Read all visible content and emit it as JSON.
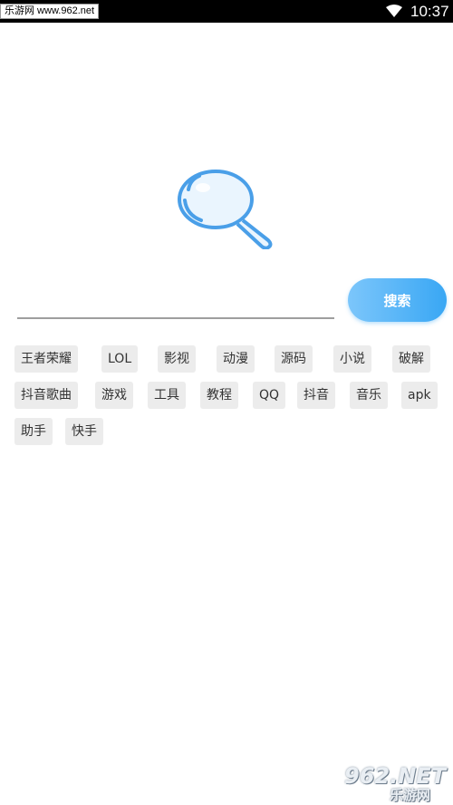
{
  "status_bar": {
    "watermark": "乐游网 www.962.net",
    "time": "10:37",
    "wifi_icon": "wifi-icon"
  },
  "logo": {
    "icon": "magnifier-bubble-icon",
    "color": "#4a9fe8"
  },
  "search": {
    "input_value": "",
    "button_label": "搜索",
    "accent": "#39a7f4"
  },
  "tags": [
    "王者荣耀",
    "LOL",
    "影视",
    "动漫",
    "源码",
    "小说",
    "破解",
    "抖音歌曲",
    "游戏",
    "工具",
    "教程",
    "QQ",
    "抖音",
    "音乐",
    "apk",
    "助手",
    "快手"
  ],
  "watermark_corner": {
    "top": "962.NET",
    "bottom": "乐游网"
  }
}
